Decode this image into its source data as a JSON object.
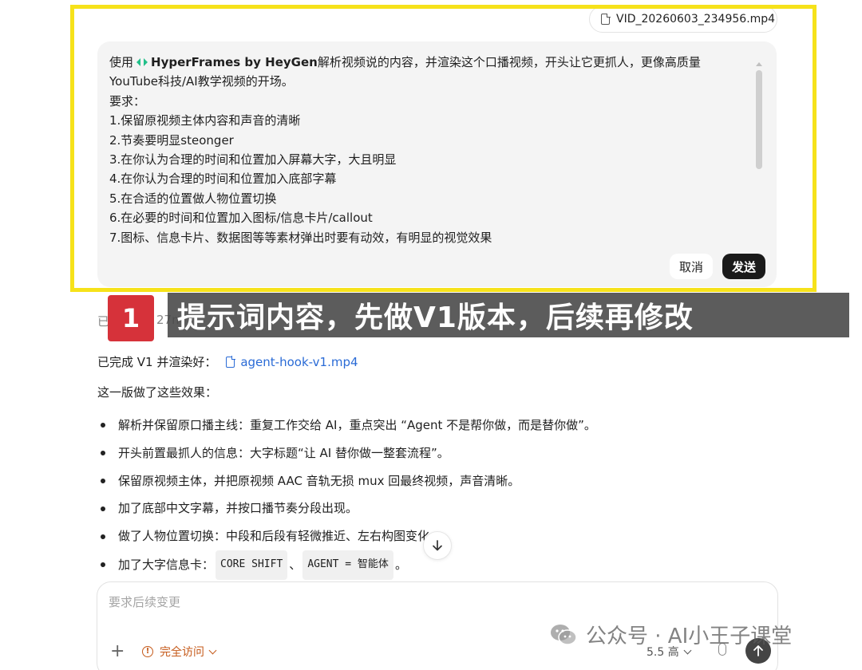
{
  "attachment": {
    "filename": "VID_20260603_234956.mp4"
  },
  "prompt": {
    "line1_prefix": "使用",
    "brand": "HyperFrames by HeyGen",
    "line1_suffix": "解析视频说的内容，并渲染这个口播视频，开头让它更抓人，更像高质量",
    "line2": "YouTube科技/AI教学视频的开场。",
    "line3": "要求：",
    "line4": "1.保留原视频主体内容和声音的清晰",
    "line5": "2.节奏要明显steonger",
    "line6": "3.在你认为合理的时间和位置加入屏幕大字，大且明显",
    "line7": "4.在你认为合理的时间和位置加入底部字幕",
    "line8": "5.在合适的位置做人物位置切换",
    "line9": "6.在必要的时间和位置加入图标/信息卡片/callout",
    "line10": "7.图标、信息卡片、数据图等等素材弹出时要有动效，有明显的视觉效果",
    "cancel_label": "取消",
    "send_label": "发送"
  },
  "overlay": {
    "step_number": "1",
    "caption": "提示词内容，先做V1版本，后续再修改"
  },
  "behind": {
    "text_a": "已",
    "text_b": "27m"
  },
  "response": {
    "done_prefix": "已完成 V1 并渲染好：",
    "file_link": "agent-hook-v1.mp4",
    "effects_intro": "这一版做了这些效果：",
    "bullets": [
      "解析并保留原口播主线：重复工作交给 AI，重点突出 “Agent 不是帮你做，而是替你做”。",
      "开头前置最抓人的信息：大字标题“让 AI 替你做一整套流程”。",
      "保留原视频主体，并把原视频 AAC 音轨无损 mux 回最终视频，声音清晰。",
      "加了底部中文字幕，并按口播节奏分段出现。",
      "做了人物位置切换：中段和后段有轻微推近、左右构图变化。"
    ],
    "last_bullet_prefix": "加了大字信息卡：",
    "tag1": "CORE SHIFT",
    "separator": "、",
    "tag2": "AGENT = 智能体",
    "last_bullet_suffix": "。"
  },
  "composer": {
    "placeholder": "要求后续变更",
    "plus": "+",
    "access_label": "完全访问",
    "model_label": "5.5 高"
  },
  "watermark": {
    "text": "公众号 · AI小王子课堂"
  },
  "colors": {
    "highlight": "#f6e21a",
    "badge": "#d6323a",
    "link": "#2a6bd6",
    "access": "#c55a1a",
    "brand_icon": "#22c08a"
  },
  "icons": {
    "attachment": "file-icon",
    "brand": "hyperframes-logo-icon",
    "link": "file-icon",
    "scroll_down": "arrow-down-icon",
    "access": "warning-circle-icon",
    "chevron": "chevron-down-icon",
    "mic": "microphone-icon",
    "send": "arrow-up-icon",
    "watermark": "wechat-icon"
  }
}
